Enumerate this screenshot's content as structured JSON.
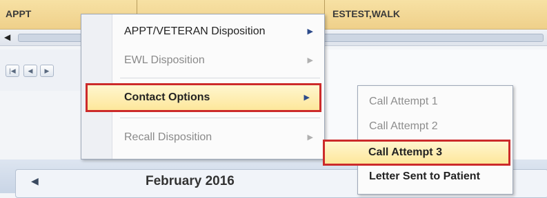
{
  "header": {
    "col1": "APPT",
    "col2": "ESTEST,WALK"
  },
  "scroll": {
    "left_arrow": "◀"
  },
  "nav": {
    "first": "|◀",
    "prev": "◀",
    "next": "▶"
  },
  "calendar": {
    "prev": "◀",
    "title": "February 2016"
  },
  "context_menu": {
    "items": [
      {
        "label": "APPT/VETERAN Disposition",
        "arrow": "▶",
        "enabled": true
      },
      {
        "label": "EWL Disposition",
        "arrow": "▶",
        "enabled": false
      },
      {
        "label": "Contact Options",
        "arrow": "▶",
        "enabled": true,
        "highlighted": true
      },
      {
        "label": "Recall Disposition",
        "arrow": "▶",
        "enabled": false
      }
    ]
  },
  "submenu": {
    "items": [
      {
        "label": "Call Attempt 1",
        "enabled": false
      },
      {
        "label": "Call Attempt 2",
        "enabled": false
      },
      {
        "label": "Call Attempt 3",
        "enabled": true,
        "highlighted": true
      },
      {
        "label": "Letter Sent to Patient",
        "enabled": true
      }
    ]
  },
  "colors": {
    "highlight_border": "#cc2a2a",
    "header_bg": "#f2d898"
  }
}
